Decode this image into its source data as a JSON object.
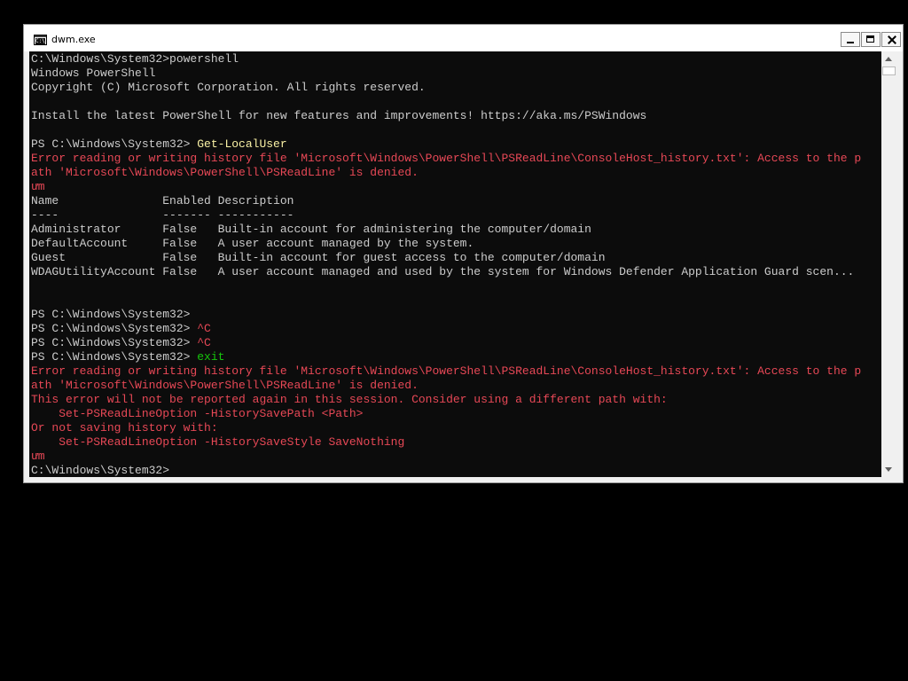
{
  "window": {
    "title": "dwm.exe",
    "icon": "console-icon",
    "icon_text": "C:\\"
  },
  "controls": {
    "minimize": "minimize-icon",
    "maximize": "maximize-icon",
    "close": "close-icon"
  },
  "console": {
    "lines": [
      {
        "text": "C:\\Windows\\System32>powershell"
      },
      {
        "text": "Windows PowerShell"
      },
      {
        "text": "Copyright (C) Microsoft Corporation. All rights reserved."
      },
      {
        "text": ""
      },
      {
        "text": "Install the latest PowerShell for new features and improvements! https://aka.ms/PSWindows"
      },
      {
        "text": ""
      },
      {
        "prompt": "PS C:\\Windows\\System32> ",
        "cmd": "Get-LocalUser"
      },
      {
        "text": "Error reading or writing history file 'Microsoft\\Windows\\PowerShell\\PSReadLine\\ConsoleHost_history.txt': Access to the p",
        "type": "error"
      },
      {
        "text": "ath 'Microsoft\\Windows\\PowerShell\\PSReadLine' is denied.",
        "type": "error"
      },
      {
        "text": "ưm",
        "type": "error"
      },
      {
        "text": "Name               Enabled Description"
      },
      {
        "text": "----               ------- -----------"
      },
      {
        "text": "Administrator      False   Built-in account for administering the computer/domain"
      },
      {
        "text": "DefaultAccount     False   A user account managed by the system."
      },
      {
        "text": "Guest              False   Built-in account for guest access to the computer/domain"
      },
      {
        "text": "WDAGUtilityAccount False   A user account managed and used by the system for Windows Defender Application Guard scen..."
      },
      {
        "text": ""
      },
      {
        "text": ""
      },
      {
        "text": "PS C:\\Windows\\System32>"
      },
      {
        "prompt": "PS C:\\Windows\\System32> ",
        "cmd": "^C",
        "cmd_type": "error"
      },
      {
        "prompt": "PS C:\\Windows\\System32> ",
        "cmd": "^C",
        "cmd_type": "error"
      },
      {
        "prompt": "PS C:\\Windows\\System32> ",
        "cmd": "exit",
        "cmd_type": "green"
      },
      {
        "text": "Error reading or writing history file 'Microsoft\\Windows\\PowerShell\\PSReadLine\\ConsoleHost_history.txt': Access to the p",
        "type": "error"
      },
      {
        "text": "ath 'Microsoft\\Windows\\PowerShell\\PSReadLine' is denied.",
        "type": "error"
      },
      {
        "text": "This error will not be reported again in this session. Consider using a different path with:",
        "type": "error"
      },
      {
        "text": "    Set-PSReadLineOption -HistorySavePath <Path>",
        "type": "error"
      },
      {
        "text": "Or not saving history with:",
        "type": "error"
      },
      {
        "text": "    Set-PSReadLineOption -HistorySaveStyle SaveNothing",
        "type": "error"
      },
      {
        "text": "ưm",
        "type": "error"
      },
      {
        "text": "C:\\Windows\\System32>"
      }
    ]
  },
  "scrollbar": {
    "up": "scroll-up-arrow-icon",
    "down": "scroll-down-arrow-icon"
  },
  "colors": {
    "console_bg": "#0c0c0c",
    "text": "#cccccc",
    "error": "#e74856",
    "command": "#f9f1a5",
    "green": "#16c60c"
  }
}
